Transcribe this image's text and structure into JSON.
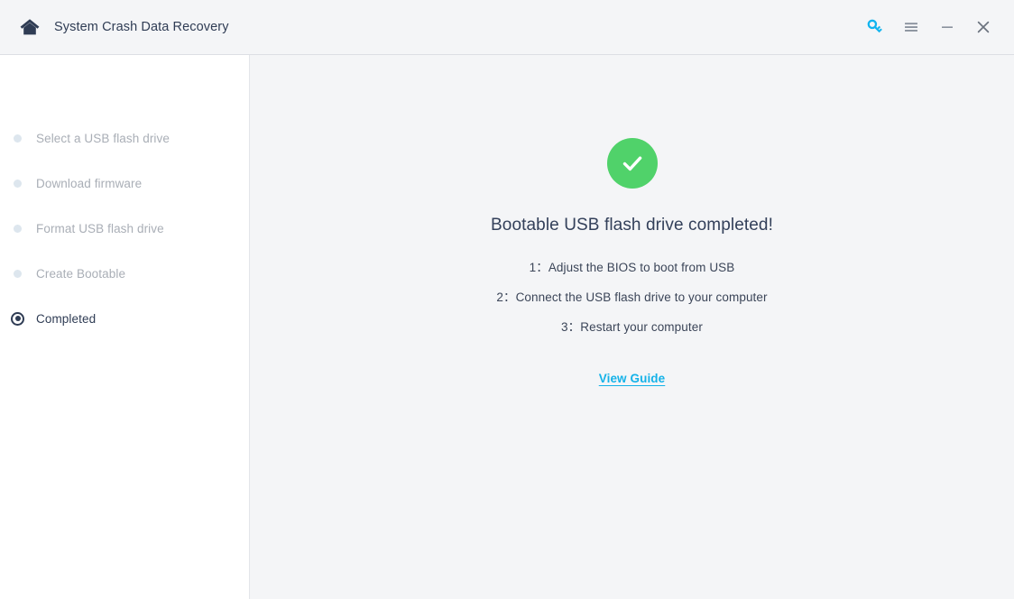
{
  "window": {
    "title": "System Crash Data Recovery",
    "home_icon": "home-icon",
    "actions": [
      {
        "name": "key-icon",
        "label": "",
        "color": "#14b2e8"
      },
      {
        "name": "menu-icon",
        "label": "",
        "color": "#8a929e"
      },
      {
        "name": "minimize-icon",
        "label": "",
        "color": "#8a929e"
      },
      {
        "name": "close-icon",
        "label": "",
        "color": "#6b737f"
      }
    ]
  },
  "sidebar": {
    "steps": [
      {
        "label": "Select a USB flash drive",
        "state": "idle"
      },
      {
        "label": "Download firmware",
        "state": "idle"
      },
      {
        "label": "Format USB flash drive",
        "state": "idle"
      },
      {
        "label": "Create Bootable",
        "state": "idle"
      },
      {
        "label": "Completed",
        "state": "active"
      }
    ]
  },
  "main": {
    "status_icon": "check-circle-icon",
    "status_color": "#50d26a",
    "headline": "Bootable USB flash drive completed!",
    "instructions": [
      {
        "num": "1：",
        "text": "Adjust the BIOS to boot from USB"
      },
      {
        "num": "2：",
        "text": "Connect the USB flash drive to your computer"
      },
      {
        "num": "3：",
        "text": "Restart your computer"
      }
    ],
    "guide_link": "View Guide",
    "link_color": "#14b2e8"
  }
}
